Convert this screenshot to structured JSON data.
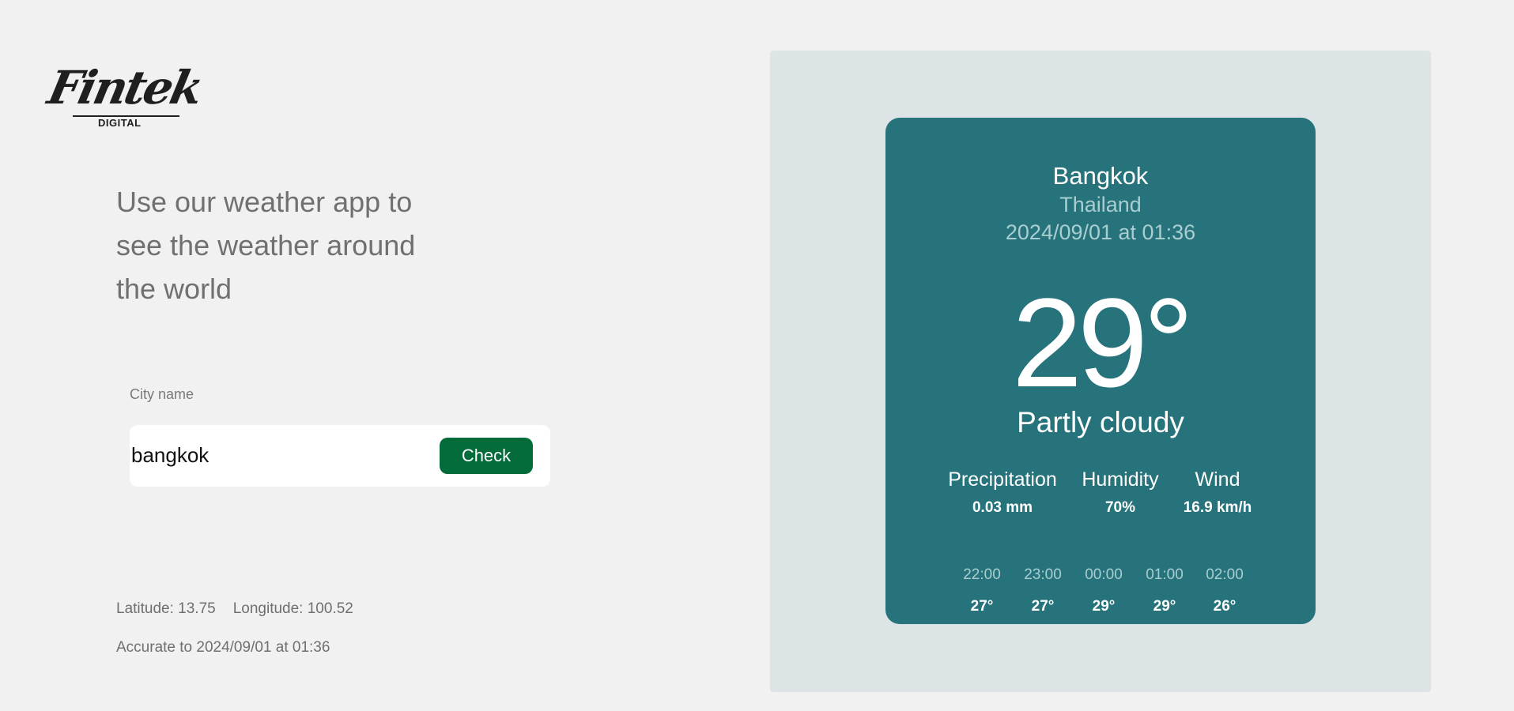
{
  "logo": {
    "script_text": "Fintek",
    "sub_text": "DIGITAL"
  },
  "intro": {
    "tagline": "Use our weather app to see the weather around the world"
  },
  "search": {
    "label": "City name",
    "value": "bangkok",
    "button_label": "Check"
  },
  "location_info": {
    "latitude": "Latitude: 13.75",
    "longitude": "Longitude: 100.52",
    "accuracy": "Accurate to 2024/09/01 at 01:36"
  },
  "weather": {
    "city": "Bangkok",
    "country": "Thailand",
    "datetime": "2024/09/01 at 01:36",
    "temperature": "29°",
    "condition": "Partly cloudy",
    "stats": [
      {
        "label": "Precipitation",
        "value": "0.03 mm"
      },
      {
        "label": "Humidity",
        "value": "70%"
      },
      {
        "label": "Wind",
        "value": "16.9 km/h"
      }
    ],
    "hourly": [
      {
        "time": "22:00",
        "temp": "27°"
      },
      {
        "time": "23:00",
        "temp": "27°"
      },
      {
        "time": "00:00",
        "temp": "29°"
      },
      {
        "time": "01:00",
        "temp": "29°"
      },
      {
        "time": "02:00",
        "temp": "26°"
      }
    ]
  },
  "colors": {
    "background": "#f1f1f1",
    "panel": "#dde4e6",
    "card": "#26737c",
    "button": "#046c3a",
    "muted_text": "#a9cdd0"
  }
}
